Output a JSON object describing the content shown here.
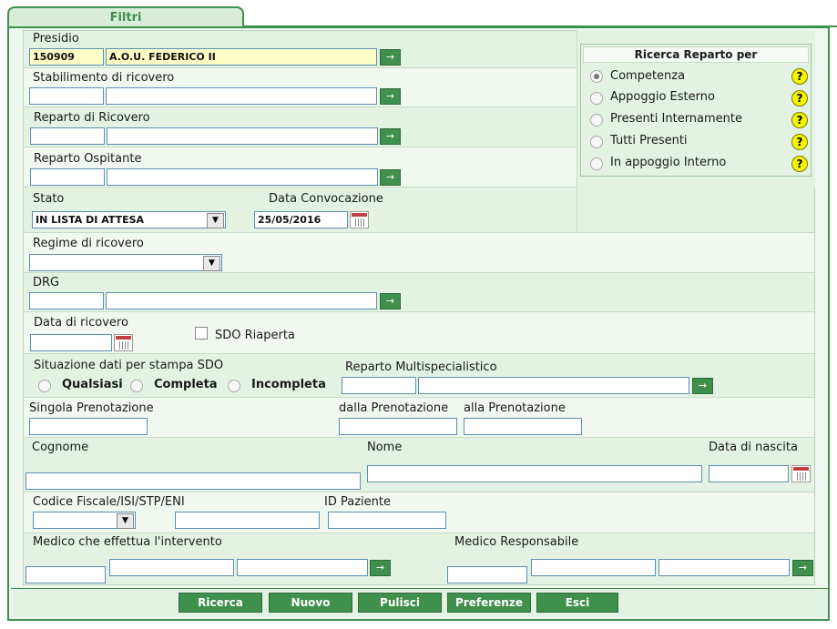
{
  "tab": {
    "title": "Filtri"
  },
  "presidio": {
    "label": "Presidio",
    "code": "150909",
    "name": "A.O.U. FEDERICO II"
  },
  "stabilimento": {
    "label": "Stabilimento di ricovero"
  },
  "reparto_ricovero": {
    "label": "Reparto di Ricovero"
  },
  "reparto_ospitante": {
    "label": "Reparto Ospitante"
  },
  "stato": {
    "label": "Stato",
    "value": "IN LISTA DI ATTESA"
  },
  "data_convocazione": {
    "label": "Data Convocazione",
    "value": "25/05/2016"
  },
  "regime": {
    "label": "Regime di ricovero"
  },
  "drg": {
    "label": "DRG"
  },
  "data_ricovero": {
    "label": "Data di ricovero"
  },
  "sdo_riaperta": {
    "label": "SDO Riaperta",
    "checked": false
  },
  "situazione": {
    "label": "Situazione dati per stampa SDO",
    "options": [
      "Qualsiasi",
      "Completa",
      "Incompleta"
    ]
  },
  "reparto_multi": {
    "label": "Reparto Multispecialistico"
  },
  "prenotazione": {
    "singola": "Singola Prenotazione",
    "dalla": "dalla Prenotazione",
    "alla": "alla Prenotazione"
  },
  "anagrafica": {
    "cognome": "Cognome",
    "nome": "Nome",
    "data_nascita": "Data di nascita"
  },
  "codici": {
    "codice_fiscale": "Codice Fiscale/ISI/STP/ENI",
    "id_paziente": "ID Paziente"
  },
  "medici": {
    "intervento": "Medico che effettua l'intervento",
    "responsabile": "Medico Responsabile"
  },
  "ricerca_reparto": {
    "title": "Ricerca Reparto per",
    "options": [
      "Competenza",
      "Appoggio Esterno",
      "Presenti Internamente",
      "Tutti Presenti",
      "In appoggio Interno"
    ],
    "selected": "Competenza",
    "help_glyph": "?"
  },
  "icons": {
    "arrow": "→",
    "dropdown": "▼"
  },
  "buttons": {
    "ricerca": "Ricerca",
    "nuovo": "Nuovo",
    "pulisci": "Pulisci",
    "preferenze": "Preferenze",
    "esci": "Esci"
  },
  "colors": {
    "accent": "#3f8f4d",
    "panel": "#eef7ee",
    "field_highlight": "#fdfdc6",
    "help": "#f4f400"
  }
}
